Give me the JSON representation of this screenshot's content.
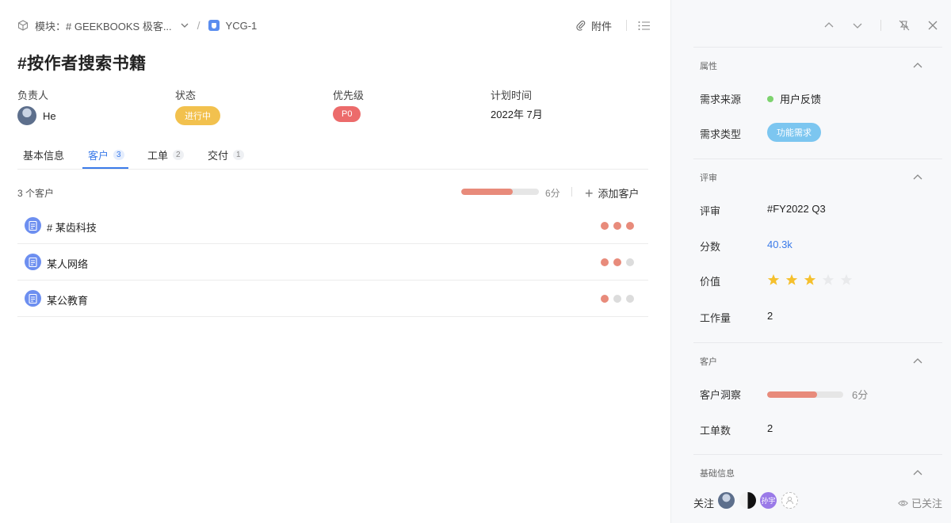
{
  "header": {
    "module_label": "模块：# GEEKBOOKS 极客...",
    "issue_id": "YCG-1",
    "attach_label": "附件"
  },
  "title": "#按作者搜索书籍",
  "fields": {
    "assignee": {
      "label": "负责人",
      "value": "He"
    },
    "status": {
      "label": "状态",
      "value": "进行中",
      "color": "#f2c14e"
    },
    "priority": {
      "label": "优先级",
      "value": "P0",
      "color": "#ec6b6b"
    },
    "plan_time": {
      "label": "计划时间",
      "value": "2022年 7月"
    }
  },
  "tabs": [
    {
      "label": "基本信息",
      "count": ""
    },
    {
      "label": "客户",
      "count": "3",
      "active": true
    },
    {
      "label": "工单",
      "count": "2"
    },
    {
      "label": "交付",
      "count": "1"
    }
  ],
  "customers": {
    "count_label": "3 个客户",
    "progress": 0.66,
    "score": "6分",
    "add_label": "添加客户",
    "items": [
      {
        "name": "# 某齿科技",
        "level": 3
      },
      {
        "name": "某人网络",
        "level": 2
      },
      {
        "name": "某公教育",
        "level": 1
      }
    ]
  },
  "panel": {
    "sections": {
      "attributes": "属性",
      "review": "评审",
      "customer": "客户",
      "basic": "基础信息"
    },
    "source": {
      "label": "需求来源",
      "value": "用户反馈"
    },
    "type": {
      "label": "需求类型",
      "value": "功能需求"
    },
    "review": {
      "label": "评审",
      "value": "#FY2022 Q3"
    },
    "score": {
      "label": "分数",
      "value": "40.3k"
    },
    "value": {
      "label": "价值",
      "stars": 3,
      "max": 5
    },
    "workload": {
      "label": "工作量",
      "value": "2"
    },
    "insight": {
      "label": "客户洞察",
      "progress": 0.66,
      "score": "6分"
    },
    "tickets": {
      "label": "工单数",
      "value": "2"
    },
    "followers": {
      "label": "关注",
      "third_name": "孙宇",
      "status": "已关注"
    }
  },
  "colors": {
    "accent": "#3b7be9",
    "progress": "#e88b7b"
  }
}
